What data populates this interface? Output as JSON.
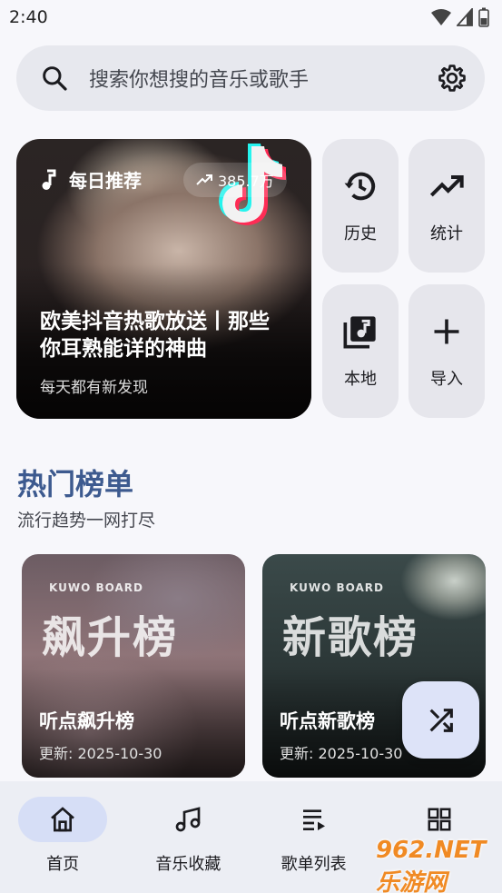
{
  "status_bar": {
    "time": "2:40"
  },
  "search": {
    "placeholder": "搜索你想搜的音乐或歌手"
  },
  "daily": {
    "label": "每日推荐",
    "plays": "385.7万",
    "title": "欧美抖音热歌放送丨那些你耳熟能详的神曲",
    "subtitle": "每天都有新发现"
  },
  "tiles": [
    {
      "label": "历史",
      "icon": "history-icon"
    },
    {
      "label": "统计",
      "icon": "trending-icon"
    },
    {
      "label": "本地",
      "icon": "local-music-icon"
    },
    {
      "label": "导入",
      "icon": "plus-icon"
    }
  ],
  "section": {
    "title": "热门榜单",
    "subtitle": "流行趋势一网打尽"
  },
  "charts": [
    {
      "brand": "KUWO BOARD",
      "art_title": "飙升榜",
      "name": "听点飙升榜",
      "updated": "更新: 2025-10-30"
    },
    {
      "brand": "KUWO BOARD",
      "art_title": "新歌榜",
      "name": "听点新歌榜",
      "updated": "更新: 2025-10-30"
    }
  ],
  "nav": [
    {
      "label": "首页",
      "icon": "home-icon",
      "active": true
    },
    {
      "label": "音乐收藏",
      "icon": "music-note-icon",
      "active": false
    },
    {
      "label": "歌单列表",
      "icon": "playlist-icon",
      "active": false
    },
    {
      "label": "",
      "icon": "grid-icon",
      "active": false
    }
  ],
  "watermark": "962.NET 乐游网",
  "colors": {
    "accent": "#3d5a8f",
    "active_indicator": "#d6def6",
    "fab": "#dde3f8"
  }
}
